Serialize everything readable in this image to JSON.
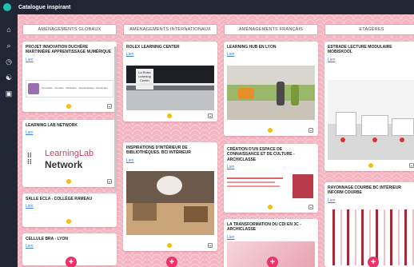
{
  "app": {
    "title": "Catalogue inspirant"
  },
  "sidebar": {
    "icons": [
      "home-icon",
      "search-icon",
      "clock-icon",
      "at-icon",
      "play-icon"
    ],
    "glyphs": [
      "⌂",
      "⌕",
      "◷",
      "☯",
      "▣"
    ]
  },
  "columns": [
    {
      "title": "AMÉNAGEMENTS GLOBAUX"
    },
    {
      "title": "AMÉNAGEMENTS INTERNATIONAUX"
    },
    {
      "title": "AMÉNAGEMENTS FRANÇAIS"
    },
    {
      "title": "ETAGÈRES"
    }
  ],
  "cards": {
    "c1a": {
      "title": "PROJET INNOVATION DUCHÈRE MARTINIÈRE APPRENTISSAGE NUMÉRIQUE",
      "link": "Lien",
      "caption": "Innovation · Duchère · Martinière · Apprentissage · Numérique"
    },
    "c1b": {
      "title": "LEARNING LAB NETWORK",
      "link": "Lien",
      "logo_line1": "LearningLab",
      "logo_line2": "Network"
    },
    "c1c": {
      "title": "SALLE ECLA - COLLÈGE RAMEAU",
      "link": "Lien"
    },
    "c1d": {
      "title": "CELLULE BRA - LYON",
      "link": "Lien"
    },
    "c2a": {
      "title": "ROLEX LEARNING CENTER",
      "link": "Lien",
      "sign": "La Rolex Learning Center"
    },
    "c2b": {
      "title": "INSPIRATIONS D'INTÉRIEUR DE BIBLIOTHÈQUES. BCI INTÉRIEUR",
      "link": "Lien"
    },
    "c3a": {
      "title": "LEARNING HUB EN LYON",
      "link": "Lien"
    },
    "c3b": {
      "title": "CRÉATION D'UN ESPACE DE CONNAISSANCE ET DE CULTURE - ARCHICLASSE",
      "link": "Lien"
    },
    "c3c": {
      "title": "LA TRANSFORMATION DU CDI EN 3C - ARCHICLASSE",
      "link": "Lien"
    },
    "c4a": {
      "title": "ESTRADE LECTURE MODULAIRE MOBISKOOL",
      "link": "Lien"
    },
    "c4b": {
      "title": "RAYONNAGE COURBE BC INTÉRIEUR INFORM COURBE",
      "link": "Lien"
    }
  },
  "add_button": "+",
  "colors": {
    "background": "#f4b6c2",
    "topbar": "#1e2733",
    "accent": "#e8336b",
    "dot": "#f2c10c",
    "link": "#3a7fd4"
  }
}
